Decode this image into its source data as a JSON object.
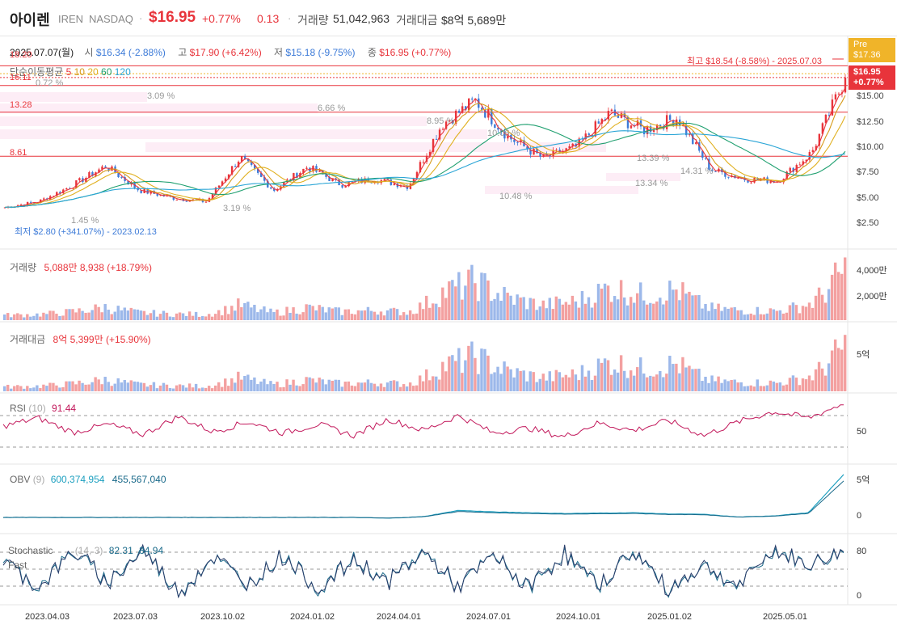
{
  "header": {
    "name": "아이렌",
    "ticker": "IREN",
    "exchange": "NASDAQ",
    "price": "$16.95",
    "change_pct": "+0.77%",
    "change_abs": "0.13",
    "volume_label": "거래량",
    "volume": "51,042,963",
    "value_label": "거래대금",
    "value": "$8억 5,689만"
  },
  "ohlc": {
    "date": "2025.07.07(월)",
    "open_label": "시",
    "open": "$16.34 (-2.88%)",
    "high_label": "고",
    "high": "$17.90 (+6.42%)",
    "low_label": "저",
    "low": "$15.18 (-9.75%)",
    "close_label": "종",
    "close": "$16.95 (+0.77%)"
  },
  "ma": {
    "label": "단순이동평균",
    "periods": [
      "5",
      "10",
      "20",
      "60",
      "120"
    ],
    "colors": [
      "#e8343b",
      "#d69a1a",
      "#e0b020",
      "#20a070",
      "#2aa5d6"
    ]
  },
  "badges": {
    "pre_label": "Pre",
    "pre_price": "$17.36",
    "cur_price": "$16.95",
    "cur_pct": "+0.77%"
  },
  "annotations": {
    "high": "최고 $18.54 (-8.58%) - 2025.07.03",
    "low": "최저 $2.80 (+341.07%) - 2023.02.13",
    "line_labels": [
      "18.20",
      "16.11",
      "13.28",
      "8.61"
    ],
    "zone_pcts": [
      "0.72 %",
      "3.09 %",
      "6.66 %",
      "8.95 %",
      "10.48 %",
      "13.39 %",
      "14.31 %",
      "13.34 %",
      "10.06 %",
      "1.45 %",
      "3.19 %"
    ]
  },
  "panels": {
    "volume": {
      "label": "거래량",
      "value": "5,088만 8,938 (+18.79%)",
      "axis": [
        "4,000만",
        "2,000만"
      ]
    },
    "amount": {
      "label": "거래대금",
      "value": "8억 5,399만 (+15.90%)",
      "axis": [
        "5억"
      ]
    },
    "rsi": {
      "label": "RSI",
      "period": "(10)",
      "value": "91.44",
      "axis": [
        "50"
      ]
    },
    "obv": {
      "label": "OBV",
      "period": "(9)",
      "value1": "600,374,954",
      "value2": "455,567,040",
      "axis": [
        "5억",
        "0"
      ]
    },
    "stoch": {
      "label": "Stochastic",
      "label2": "Fast",
      "period": "(14, 3)",
      "value1": "82.31",
      "value2": "84.94",
      "axis": [
        "80",
        "0"
      ]
    }
  },
  "chart_data": {
    "type": "line",
    "title": "",
    "x_ticks": [
      "2023.04.03",
      "2023.07.03",
      "2023.10.02",
      "2024.01.02",
      "2024.04.01",
      "2024.07.01",
      "2024.10.01",
      "2025.01.02",
      "2025.05.01"
    ],
    "y_ticks": [
      "$15.00",
      "$12.50",
      "$10.00",
      "$7.50",
      "$5.00",
      "$2.50"
    ],
    "ylim": [
      0.5,
      19
    ],
    "series": [
      {
        "name": "",
        "x": [
          "2023.02",
          "2023.04",
          "2023.06",
          "2023.07",
          "2023.09",
          "2023.10",
          "2023.12",
          "2024.01",
          "2024.02",
          "2024.03",
          "2024.04",
          "2024.05",
          "2024.06",
          "2024.07",
          "2024.08",
          "2024.09",
          "2024.10",
          "2024.11",
          "2024.12",
          "2025.01",
          "2025.02",
          "2025.03",
          "2025.04",
          "2025.05",
          "2025.06",
          "2025.07"
        ],
        "values": [
          3.2,
          3.8,
          5.5,
          7.6,
          5.0,
          4.2,
          3.8,
          8.5,
          5.0,
          7.5,
          5.6,
          6.2,
          5.4,
          12.0,
          14.5,
          10.6,
          8.4,
          9.6,
          13.2,
          11.4,
          12.7,
          7.2,
          6.2,
          6.0,
          9.0,
          16.95
        ]
      }
    ],
    "rsi": [
      55,
      68,
      45,
      58,
      42,
      70,
      46,
      62,
      44,
      58,
      40,
      66,
      48,
      72,
      44,
      52,
      38,
      60,
      48,
      64,
      40,
      62,
      78,
      68,
      91
    ],
    "obv": [
      0,
      0,
      0,
      0,
      0,
      0,
      0,
      0,
      0,
      0,
      0,
      -10,
      10,
      90,
      70,
      60,
      50,
      55,
      60,
      45,
      40,
      5,
      20,
      60,
      550
    ],
    "stoch": [
      70,
      20,
      85,
      30,
      88,
      10,
      75,
      25,
      80,
      15,
      70,
      30,
      85,
      20,
      78,
      18,
      82,
      22,
      86,
      15,
      60,
      20,
      88,
      60,
      84
    ]
  }
}
